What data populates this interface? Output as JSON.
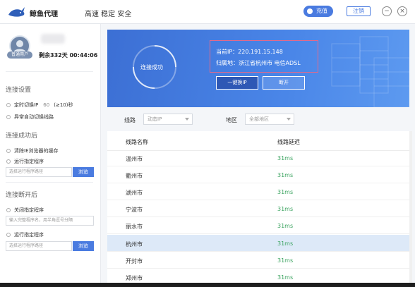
{
  "header": {
    "app_title": "鲸鱼代理",
    "tagline": "高速 稳定 安全",
    "recharge_label": "充值",
    "logout_label": "注销",
    "minimize_label": "−",
    "close_label": "×"
  },
  "account": {
    "avatar_label": "普通用户",
    "remaining": "剩余332天 00:44:06"
  },
  "sidebar": {
    "section_connect": "连接设置",
    "timed_switch_label": "定时切换IP",
    "timed_switch_value": "60",
    "timed_switch_unit": "(≥10)秒",
    "auto_switch_label": "异常自动切换线路",
    "section_after_connect": "连接成功后",
    "clear_cache_label": "清除IE浏览器的缓存",
    "run_program_label": "运行指定程序",
    "program_path_placeholder": "选择运行程序路径",
    "browse_label": "浏览",
    "section_after_disconnect": "连接断开后",
    "close_program_label": "关闭指定程序",
    "close_program_placeholder": "输入完整程序名，用半角逗号分隔",
    "run_program2_label": "运行指定程序",
    "program_path2_placeholder": "选择运行程序路径",
    "browse2_label": "浏览"
  },
  "status": {
    "connection_text": "连接成功",
    "current_ip": "当前IP：220.191.15.148",
    "location": "归属地：浙江省杭州市 电信ADSL",
    "switch_ip_label": "一键换IP",
    "disconnect_label": "断开"
  },
  "filters": {
    "line_label": "线路",
    "line_value": "动态IP",
    "region_label": "地区",
    "region_value": "全部地区"
  },
  "table": {
    "col_name": "线路名称",
    "col_latency": "线路延迟",
    "rows": [
      {
        "name": "温州市",
        "latency": "31ms"
      },
      {
        "name": "衢州市",
        "latency": "31ms"
      },
      {
        "name": "湖州市",
        "latency": "31ms"
      },
      {
        "name": "宁波市",
        "latency": "31ms"
      },
      {
        "name": "丽水市",
        "latency": "31ms"
      },
      {
        "name": "杭州市",
        "latency": "31ms"
      },
      {
        "name": "开封市",
        "latency": "31ms"
      },
      {
        "name": "郑州市",
        "latency": "31ms"
      }
    ],
    "selected_row": 5
  },
  "colors": {
    "accent": "#4a7be0",
    "latency_green": "#3aa35f",
    "selected_row": "#dde9f8"
  }
}
